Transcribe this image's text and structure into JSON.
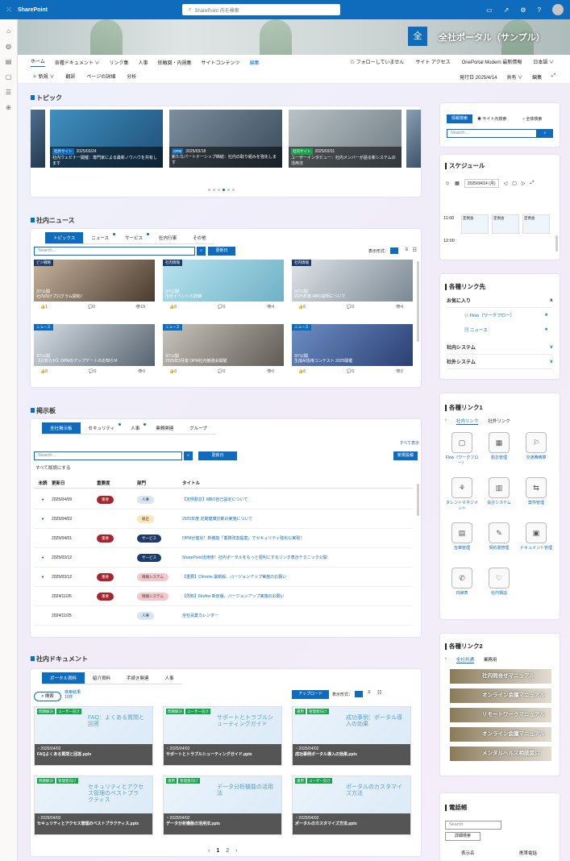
{
  "suite": {
    "brand": "SharePoint",
    "search_placeholder": "SharePoint 内を検索"
  },
  "site": {
    "logo_char": "全",
    "title": "全社ポータル（サンプル）"
  },
  "nav": {
    "items": [
      "ホーム",
      "各種ドキュメント ∨",
      "リンク集",
      "人事",
      "依頼図・内規集",
      "サイトコンテンツ"
    ],
    "edit": "編集",
    "follow": "☆ フォローしていません",
    "access": "サイト アクセス",
    "onepoint": "OnePortal Modern 最新情報",
    "lang": "日本語 ∨"
  },
  "cmd": {
    "new": "＋ 新規 ∨",
    "translate": "翻訳",
    "details": "ページの詳細",
    "analytics": "分析",
    "published": "発行日 2025/4/14",
    "share": "共有 ∨",
    "edit": "編集"
  },
  "topics": {
    "title": "トピック",
    "cards": [
      {
        "tag": "社外サイト",
        "date": "2025/03/24",
        "text": "社内ウェビナー開催：専門家による最新ノウハウを共有します"
      },
      {
        "tag": "OPM",
        "date": "2025/03/18",
        "text": "新たなパートナーシップ締結：社内の取り組みを強化します"
      },
      {
        "tag": "社内サイト",
        "date": "2025/03/11",
        "text": "ユーザーインタビュー：社内メンバーが語る新システムの活用法"
      }
    ]
  },
  "news": {
    "title": "社内ニュース",
    "tabs": [
      "トピックス",
      "ニュース",
      "サービス",
      "社内行事",
      "その他"
    ],
    "search_placeholder": "Search...",
    "sort": "更新日",
    "view_label": "表示形式：",
    "cards": [
      {
        "tag": "ビジ戦略",
        "cap": "3/7公開\n社内向けプログラム開始！",
        "like": "1",
        "comment": "0",
        "view": "19"
      },
      {
        "tag": "社内情報",
        "cap": "3/7公開\n今年イベントの詳細",
        "like": "0",
        "comment": "0",
        "view": "4"
      },
      {
        "tag": "社内情報",
        "cap": "3/7公開\n2025年度 MBO説明について",
        "like": "0",
        "comment": "0",
        "view": "4"
      },
      {
        "tag": "ニュース",
        "cap": "3/7公開\n【お知らせ】OPMのアップデートのお知らせ",
        "like": "0",
        "comment": "0",
        "view": "0"
      },
      {
        "tag": "ニュース",
        "cap": "3/7公開\n2025年3月度 OPM社内勉強会開催",
        "like": "0",
        "comment": "0",
        "view": "0"
      },
      {
        "tag": "ニュース",
        "cap": "3/7公開\n生成AI活用コンテスト 2025開催",
        "like": "0",
        "comment": "0",
        "view": "2"
      }
    ]
  },
  "board": {
    "title": "掲示板",
    "tabs": [
      "全社掲示板",
      "セキュリティ",
      "人事",
      "業務関連",
      "グループ"
    ],
    "show_all": "すべて表示",
    "search_placeholder": "Search...",
    "sort": "更新日",
    "new_post": "新規投稿",
    "mark_read": "すべて既読にする",
    "headers": [
      "未読",
      "更新日",
      "重要度",
      "部門",
      "タイトル"
    ],
    "rows": [
      {
        "unread": "●",
        "date": "2025/04/09",
        "prio": "重要",
        "dept": "人事",
        "title": "【定例勤怠】MBO自己設定について"
      },
      {
        "unread": "●",
        "date": "2025/04/03",
        "prio": "",
        "dept": "総企",
        "title": "2025年度 定期健康診断の実施について"
      },
      {
        "unread": "",
        "date": "2025/04/01",
        "prio": "重要",
        "dept": "サービス",
        "title": "OPMが進化！新機能「業務改善提案」でセキュリティ強化も実現！"
      },
      {
        "unread": "●",
        "date": "2025/03/12",
        "prio": "",
        "dept": "サービス",
        "title": "SharePoint活用術！社内ポータルをもっと便利にするリンク表示テクニック公開"
      },
      {
        "unread": "●",
        "date": "2025/03/12",
        "prio": "重要",
        "dept": "情報システム",
        "title": "【重要】Chrome 最新版、バージョンアップ実施のお願い"
      },
      {
        "unread": "",
        "date": "2024/11/26",
        "prio": "重要",
        "dept": "情報システム",
        "title": "【周知】Firefox 新旧版、バージョンアップ実施のお願い"
      },
      {
        "unread": "",
        "date": "2024/11/25",
        "prio": "",
        "dept": "人事",
        "title": "全社員業カレンダー"
      }
    ]
  },
  "docs": {
    "title": "社内ドキュメント",
    "tabs": [
      "ポータル資料",
      "紹介資料",
      "手続き関連",
      "人事"
    ],
    "search": "検索",
    "result": "検索結果\n10件",
    "upload": "アップロード",
    "view_label": "表示形式：",
    "cards": [
      {
        "tags": [
          "問題解決",
          "ユーザー向け"
        ],
        "big": "FAQ：よくある質問と回答",
        "date": "2025/04/02",
        "file": "FAQよくある質問と回答.pptx"
      },
      {
        "tags": [
          "問題解決",
          "ユーザー向け"
        ],
        "big": "サポートとトラブルシューティングガイド",
        "date": "2025/04/02",
        "file": "サポートとトラブルシューティングガイド.pptx"
      },
      {
        "tags": [
          "運用",
          "管理者向け"
        ],
        "big": "成功事例：ポータル導入の効果",
        "date": "2025/04/02",
        "file": "成功事例ポータル導入の効果.pptx"
      },
      {
        "tags": [
          "問題解決",
          "管理者向け"
        ],
        "big": "セキュリティとアクセス管理のベストプラクティス",
        "date": "2025/04/02",
        "file": "セキュリティとアクセス管理のベストプラクティス.pptx"
      },
      {
        "tags": [
          "運用",
          "管理者向け"
        ],
        "big": "データ分析機能の活用法",
        "date": "2025/04/02",
        "file": "データ分析機能の活用法.pptx"
      },
      {
        "tags": [
          "運用",
          "ユーザー向け"
        ],
        "big": "ポータルのカスタマイズ方法",
        "date": "2025/04/02",
        "file": "ポータルのカスタマイズ方法.pptx"
      }
    ],
    "pages": [
      "1",
      "2"
    ]
  },
  "side": {
    "search_btn": "情報検索",
    "radio1": "サイト内検索",
    "radio2": "全体検索",
    "search_placeholder": "Search...",
    "schedule": {
      "title": "スケジュール",
      "date": "2025/04/14 (月)",
      "times": [
        "11:00",
        "12:00"
      ],
      "event": "定例会"
    },
    "links": {
      "title": "各種リンク先",
      "fav": "お気に入り",
      "flow": "Flow（ワークフロー）",
      "news": "ニュース",
      "internal": "社内システム",
      "external": "社外システム"
    },
    "links1": {
      "title": "各種リンク1",
      "tabs": [
        "社内リンク",
        "社外リンク"
      ],
      "tiles": [
        "Flow（ワークフロー）",
        "勤怠管理",
        "交通費精算",
        "タレントマネジメント",
        "会計システム",
        "案件管理",
        "在庫管理",
        "契約書管理",
        "ドキュメント管理",
        "内線表",
        "社内相談"
      ]
    },
    "links2": {
      "title": "各種リンク2",
      "tabs": [
        "全社共通",
        "業務用"
      ],
      "banners": [
        "社内問合せマニュアル",
        "オンライン会議マニュアル",
        "リモートワークマニュアル",
        "オンライン会議マニュアル",
        "メンタルヘルス相談窓口"
      ]
    },
    "phone": {
      "title": "電話帳",
      "search_placeholder": "Search",
      "detail": "詳細検索",
      "col1": "表示名",
      "col2": "携帯電話"
    }
  }
}
